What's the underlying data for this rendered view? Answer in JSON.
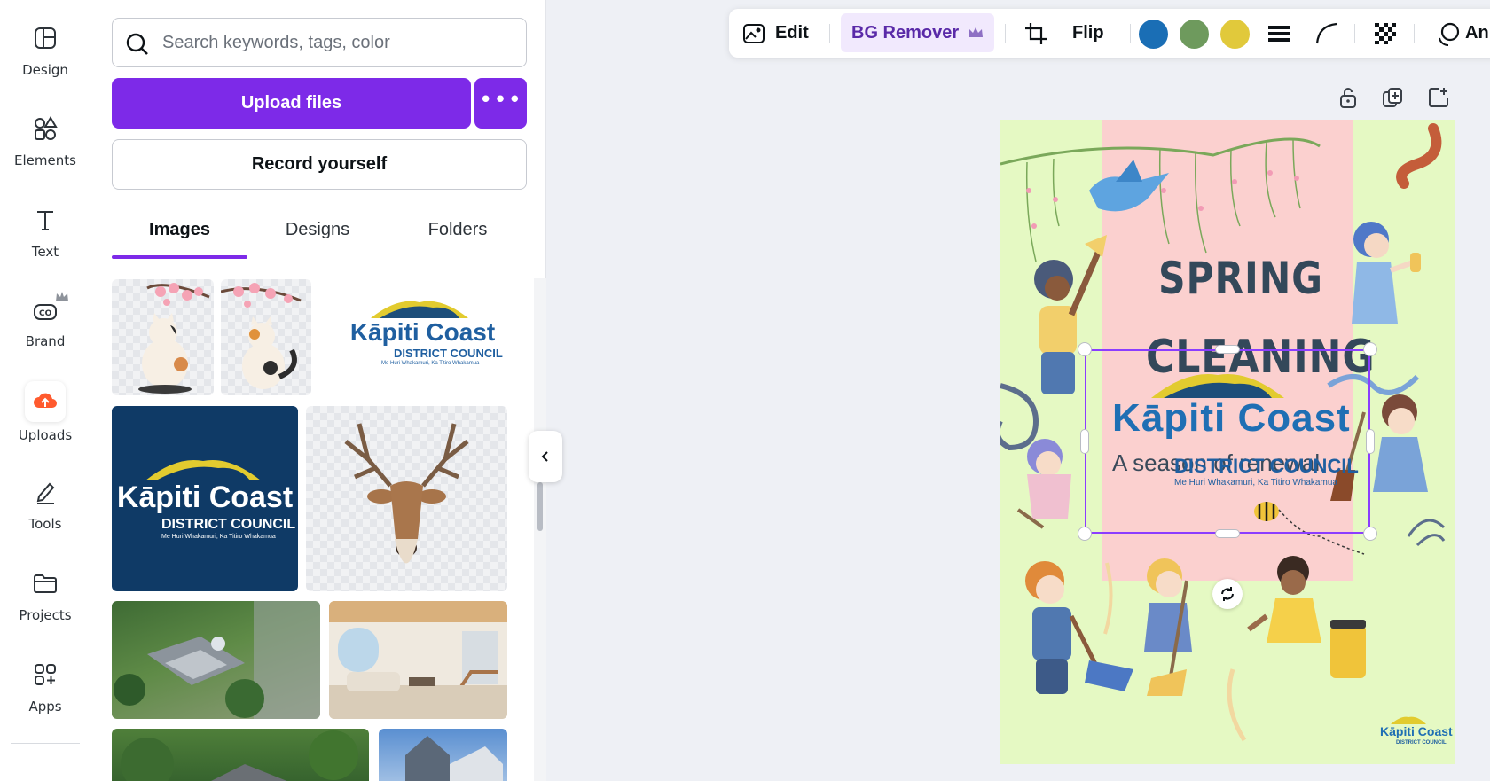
{
  "rail": {
    "items": [
      {
        "label": "Design",
        "icon": "layout-icon"
      },
      {
        "label": "Elements",
        "icon": "shapes-icon"
      },
      {
        "label": "Text",
        "icon": "text-icon"
      },
      {
        "label": "Brand",
        "icon": "brand-icon"
      },
      {
        "label": "Uploads",
        "icon": "cloud-upload-icon"
      },
      {
        "label": "Tools",
        "icon": "pen-tool-icon"
      },
      {
        "label": "Projects",
        "icon": "folder-icon"
      },
      {
        "label": "Apps",
        "icon": "apps-icon"
      }
    ],
    "active": "Uploads"
  },
  "panel": {
    "search_placeholder": "Search keywords, tags, color",
    "upload_label": "Upload files",
    "more_label": "•••",
    "record_label": "Record yourself",
    "tabs": [
      {
        "label": "Images"
      },
      {
        "label": "Designs"
      },
      {
        "label": "Folders"
      }
    ],
    "active_tab": "Images",
    "thumbs": [
      {
        "name": "cat-blossom-1"
      },
      {
        "name": "cat-blossom-2"
      },
      {
        "name": "kapiti-logo-light",
        "title": "Kāpiti Coast",
        "sub": "DISTRICT COUNCIL",
        "tag": "Me Huri Whakamuri, Ka Titiro Whakamua"
      },
      {
        "name": "kapiti-logo-dark",
        "title": "Kāpiti Coast",
        "sub": "DISTRICT COUNCIL",
        "tag": "Me Huri Whakamuri, Ka Titiro Whakamua"
      },
      {
        "name": "deer-head"
      },
      {
        "name": "aerial-house"
      },
      {
        "name": "living-room"
      },
      {
        "name": "garden-house"
      },
      {
        "name": "victorian-house"
      }
    ]
  },
  "toolbar": {
    "edit_label": "Edit",
    "bg_remover_label": "BG Remover",
    "flip_label": "Flip",
    "colors": [
      "#1a6eb5",
      "#6e9a5d",
      "#e1c93b"
    ],
    "animate_label": "An"
  },
  "canvas": {
    "title_line1": "SPRING",
    "title_line2": "CLEANING",
    "subtitle": "A season of renewal",
    "logo_title": "Kāpiti Coast",
    "logo_sub": "DISTRICT COUNCIL",
    "logo_tag": "Me Huri Whakamuri, Ka Titiro Whakamua",
    "corner_logo_title": "Kāpiti Coast",
    "corner_logo_sub": "DISTRICT COUNCIL",
    "bg_color": "#e5f9c3",
    "strip_color": "#fbd0cf",
    "accent": "#8b3dff"
  }
}
